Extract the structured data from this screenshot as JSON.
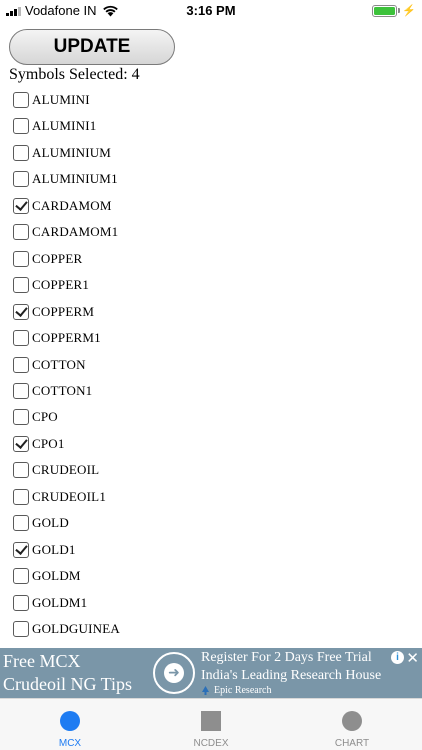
{
  "status_bar": {
    "carrier": "Vodafone IN",
    "time": "3:16 PM",
    "battery_level": 1.0,
    "icons": [
      "signal-icon",
      "wifi-icon",
      "battery-icon",
      "charging-bolt-icon"
    ]
  },
  "toolbar": {
    "update_label": "UPDATE",
    "selected_label": "Symbols Selected: 4"
  },
  "symbols": [
    {
      "name": "ALUMINI",
      "checked": false
    },
    {
      "name": "ALUMINI1",
      "checked": false
    },
    {
      "name": "ALUMINIUM",
      "checked": false
    },
    {
      "name": "ALUMINIUM1",
      "checked": false
    },
    {
      "name": "CARDAMOM",
      "checked": true
    },
    {
      "name": "CARDAMOM1",
      "checked": false
    },
    {
      "name": "COPPER",
      "checked": false
    },
    {
      "name": "COPPER1",
      "checked": false
    },
    {
      "name": "COPPERM",
      "checked": true
    },
    {
      "name": "COPPERM1",
      "checked": false
    },
    {
      "name": "COTTON",
      "checked": false
    },
    {
      "name": "COTTON1",
      "checked": false
    },
    {
      "name": "CPO",
      "checked": false
    },
    {
      "name": "CPO1",
      "checked": true
    },
    {
      "name": "CRUDEOIL",
      "checked": false
    },
    {
      "name": "CRUDEOIL1",
      "checked": false
    },
    {
      "name": "GOLD",
      "checked": false
    },
    {
      "name": "GOLD1",
      "checked": true
    },
    {
      "name": "GOLDM",
      "checked": false
    },
    {
      "name": "GOLDM1",
      "checked": false
    },
    {
      "name": "GOLDGUINEA",
      "checked": false
    }
  ],
  "ad": {
    "left_line1": "Free MCX",
    "left_line2": "Crudeoil NG Tips",
    "right_line1": "Register For 2 Days Free Trial",
    "right_line2": "India's Leading Research House",
    "brand": "Epic Research",
    "info_glyph": "i",
    "close_glyph": "✕",
    "arrow_glyph": "➜",
    "background_color": "#7a96a8"
  },
  "tabs": [
    {
      "label": "MCX",
      "icon": "circle-icon",
      "active": true,
      "color": "#1e7cf2"
    },
    {
      "label": "NCDEX",
      "icon": "square-icon",
      "active": false,
      "color": "#8e8e8e"
    },
    {
      "label": "CHART",
      "icon": "circle-icon",
      "active": false,
      "color": "#8e8e8e"
    }
  ]
}
